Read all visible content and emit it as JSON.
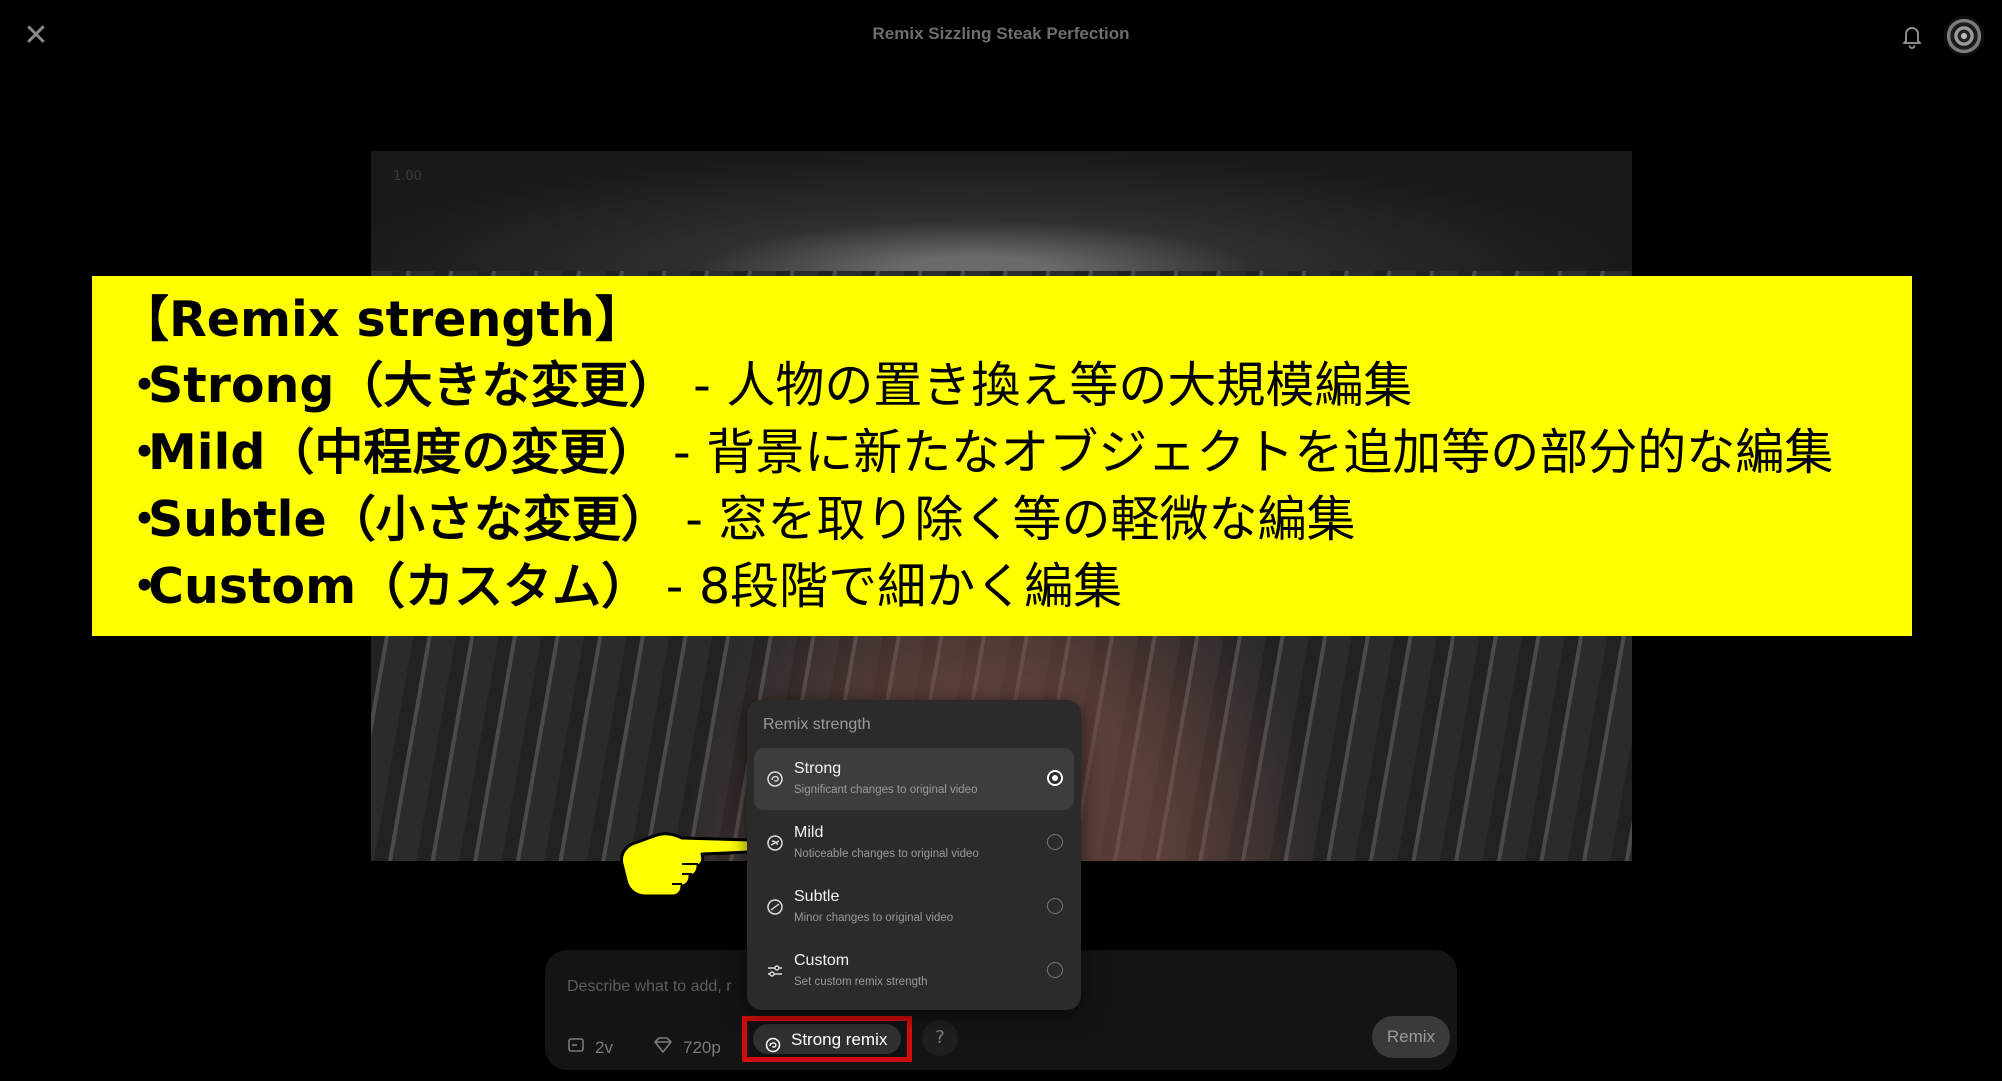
{
  "header": {
    "title": "Remix Sizzling Steak Perfection"
  },
  "video": {
    "speed": "1.00"
  },
  "overlay": {
    "heading": "【Remix strength】",
    "bullet": "・",
    "lines": [
      {
        "label": "Strong（大きな変更）",
        "desc": " - 人物の置き換え等の大規模編集"
      },
      {
        "label": "Mild（中程度の変更）",
        "desc": " - 背景に新たなオブジェクトを追加等の部分的な編集"
      },
      {
        "label": "Subtle（小さな変更）",
        "desc": " - 窓を取り除く等の軽微な編集"
      },
      {
        "label": "Custom（カスタム）",
        "desc": " - 8段階で細かく編集"
      }
    ],
    "color": "#ffff00"
  },
  "menu": {
    "title": "Remix strength",
    "options": [
      {
        "name": "Strong",
        "desc": "Significant changes to original video",
        "selected": true
      },
      {
        "name": "Mild",
        "desc": "Noticeable changes to original video",
        "selected": false
      },
      {
        "name": "Subtle",
        "desc": "Minor changes to original video",
        "selected": false
      },
      {
        "name": "Custom",
        "desc": "Set custom remix strength",
        "selected": false
      }
    ]
  },
  "composer": {
    "placeholder": "Describe what to add, r",
    "versions": "2v",
    "resolution": "720p",
    "strength_label": "Strong remix",
    "help": "?",
    "remix_label": "Remix"
  },
  "colors": {
    "highlight_border": "#d10c0c",
    "pointer": "#ffff00"
  },
  "icons": [
    "close-icon",
    "bell-icon",
    "avatar",
    "aspect-icon",
    "gem-icon",
    "remix-strength-icon",
    "pointing-hand-icon",
    "sliders-icon"
  ]
}
